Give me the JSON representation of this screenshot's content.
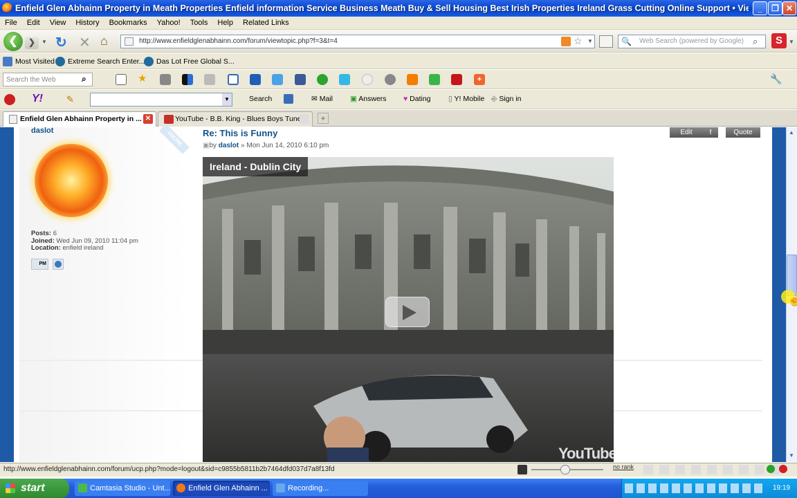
{
  "window": {
    "title": "Enfield Glen Abhainn Property in Meath Properties Enfield information Service Business Meath Buy & Sell Housing Best Irish Properties Ireland Grass Cutting Online Support • View topic - T..."
  },
  "menu": [
    "File",
    "Edit",
    "View",
    "History",
    "Bookmarks",
    "Yahoo!",
    "Tools",
    "Help",
    "Related Links"
  ],
  "nav": {
    "url": "http://www.enfieldglenabhainn.com/forum/viewtopic.php?f=3&t=4",
    "search_placeholder": "Web Search (powered by Google)"
  },
  "bookmarks": [
    "Most Visited",
    "Extreme Search Enter...",
    "Das Lot Free Global S..."
  ],
  "toolbar1": {
    "search_placeholder": "Search the Web"
  },
  "toolbar2": {
    "search": "Search",
    "mail": "Mail",
    "answers": "Answers",
    "dating": "Dating",
    "mobile": "Y! Mobile",
    "signin": "Sign in"
  },
  "tabs": [
    {
      "label": "Enfield Glen Abhainn Property in ..."
    },
    {
      "label": "YouTube - B.B. King - Blues Boys Tune"
    }
  ],
  "post": {
    "author": "daslot",
    "online": "ONLINE",
    "posts_label": "Posts:",
    "posts": "6",
    "joined_label": "Joined:",
    "joined": "Wed Jun 09, 2010 11:04 pm",
    "location_label": "Location:",
    "location": "enfield ireland",
    "pm_label": "PM",
    "title": "Re: This is Funny",
    "by": "by",
    "date": "» Mon Jun 14, 2010 6:10 pm",
    "edit": "Edit",
    "report": "!",
    "quote": "Quote",
    "video_title": "Ireland - Dublin City",
    "youtube": "YouTube"
  },
  "status": {
    "url": "http://www.enfieldglenabhainn.com/forum/ucp.php?mode=logout&sid=c9855b5811b2b7464dfd037d7a8f13fd",
    "rank": "no rank"
  },
  "taskbar": {
    "start": "start",
    "tasks": [
      "Camtasia Studio - Unt...",
      "Enfield Glen Abhainn ...",
      "Recording..."
    ],
    "clock": "19:19"
  }
}
